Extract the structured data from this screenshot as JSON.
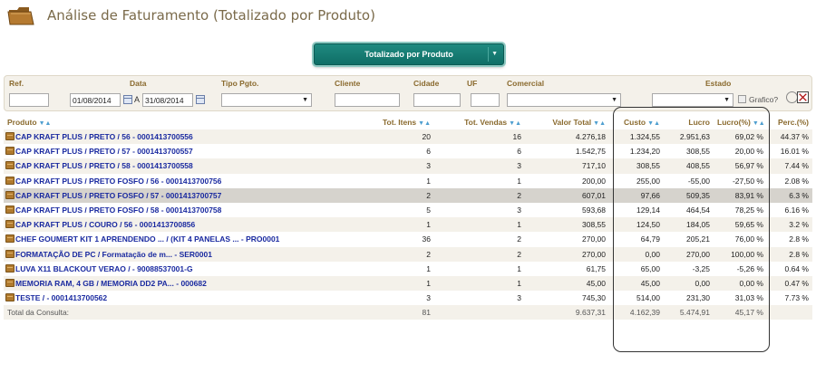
{
  "header": {
    "title": "Análise de Faturamento (Totalizado por Produto)",
    "icon": "folder-icon"
  },
  "view_select": {
    "value": "Totalizado por Produto"
  },
  "filters": {
    "labels": {
      "ref": "Ref.",
      "data": "Data",
      "tipo_pgto": "Tipo Pgto.",
      "cliente": "Cliente",
      "cidade": "Cidade",
      "uf": "UF",
      "comercial": "Comercial",
      "estado": "Estado"
    },
    "date_from": "01/08/2014",
    "date_separator": "A",
    "date_to": "31/08/2014",
    "grafico_label": "Grafico?"
  },
  "table": {
    "headers": {
      "produto": "Produto",
      "tot_itens": "Tot. Itens",
      "tot_vendas": "Tot. Vendas",
      "valor_total": "Valor Total",
      "custo": "Custo",
      "lucro": "Lucro",
      "lucro_pct": "Lucro(%)",
      "perc": "Perc.(%)"
    },
    "rows": [
      {
        "produto": "CAP KRAFT PLUS / PRETO / 56 - 0001413700556",
        "itens": "20",
        "vendas": "16",
        "valor": "4.276,18",
        "custo": "1.324,55",
        "lucro": "2.951,63",
        "lucro_pct": "69,02 %",
        "perc": "44.37 %"
      },
      {
        "produto": "CAP KRAFT PLUS / PRETO / 57 - 0001413700557",
        "itens": "6",
        "vendas": "6",
        "valor": "1.542,75",
        "custo": "1.234,20",
        "lucro": "308,55",
        "lucro_pct": "20,00 %",
        "perc": "16.01 %"
      },
      {
        "produto": "CAP KRAFT PLUS / PRETO / 58 - 0001413700558",
        "itens": "3",
        "vendas": "3",
        "valor": "717,10",
        "custo": "308,55",
        "lucro": "408,55",
        "lucro_pct": "56,97 %",
        "perc": "7.44 %"
      },
      {
        "produto": "CAP KRAFT PLUS / PRETO FOSFO / 56 - 0001413700756",
        "itens": "1",
        "vendas": "1",
        "valor": "200,00",
        "custo": "255,00",
        "lucro": "-55,00",
        "lucro_pct": "-27,50 %",
        "perc": "2.08 %"
      },
      {
        "produto": "CAP KRAFT PLUS / PRETO FOSFO / 57 - 0001413700757",
        "itens": "2",
        "vendas": "2",
        "valor": "607,01",
        "custo": "97,66",
        "lucro": "509,35",
        "lucro_pct": "83,91 %",
        "perc": "6.3 %",
        "selected": true
      },
      {
        "produto": "CAP KRAFT PLUS / PRETO FOSFO / 58 - 0001413700758",
        "itens": "5",
        "vendas": "3",
        "valor": "593,68",
        "custo": "129,14",
        "lucro": "464,54",
        "lucro_pct": "78,25 %",
        "perc": "6.16 %"
      },
      {
        "produto": "CAP KRAFT PLUS / COURO / 56 - 0001413700856",
        "itens": "1",
        "vendas": "1",
        "valor": "308,55",
        "custo": "124,50",
        "lucro": "184,05",
        "lucro_pct": "59,65 %",
        "perc": "3.2 %"
      },
      {
        "produto": "CHEF GOUMERT KIT 1 APRENDENDO ... / (KIT 4 PANELAS ... - PRO0001",
        "itens": "36",
        "vendas": "2",
        "valor": "270,00",
        "custo": "64,79",
        "lucro": "205,21",
        "lucro_pct": "76,00 %",
        "perc": "2.8 %"
      },
      {
        "produto": "FORMATAÇÃO DE PC / Formatação de m... - SER0001",
        "itens": "2",
        "vendas": "2",
        "valor": "270,00",
        "custo": "0,00",
        "lucro": "270,00",
        "lucro_pct": "100,00 %",
        "perc": "2.8 %"
      },
      {
        "produto": "LUVA X11 BLACKOUT VERAO / - 90088537001-G",
        "itens": "1",
        "vendas": "1",
        "valor": "61,75",
        "custo": "65,00",
        "lucro": "-3,25",
        "lucro_pct": "-5,26 %",
        "perc": "0.64 %"
      },
      {
        "produto": "MEMORIA RAM, 4 GB /  MEMORIA DD2 PA... - 000682",
        "itens": "1",
        "vendas": "1",
        "valor": "45,00",
        "custo": "45,00",
        "lucro": "0,00",
        "lucro_pct": "0,00 %",
        "perc": "0.47 %"
      },
      {
        "produto": "TESTE / - 0001413700562",
        "itens": "3",
        "vendas": "3",
        "valor": "745,30",
        "custo": "514,00",
        "lucro": "231,30",
        "lucro_pct": "31,03 %",
        "perc": "7.73 %"
      }
    ],
    "totals": {
      "label": "Total da Consulta:",
      "itens": "81",
      "valor": "9.637,31",
      "custo": "4.162,39",
      "lucro": "5.474,91",
      "lucro_pct": "45,17 %"
    }
  },
  "colors": {
    "accent_teal": "#1f8a80",
    "header_label": "#8a6a2e",
    "product_link": "#1a2aa0",
    "row_alt": "#f4f1ea",
    "row_selected": "#d6d3cd"
  }
}
